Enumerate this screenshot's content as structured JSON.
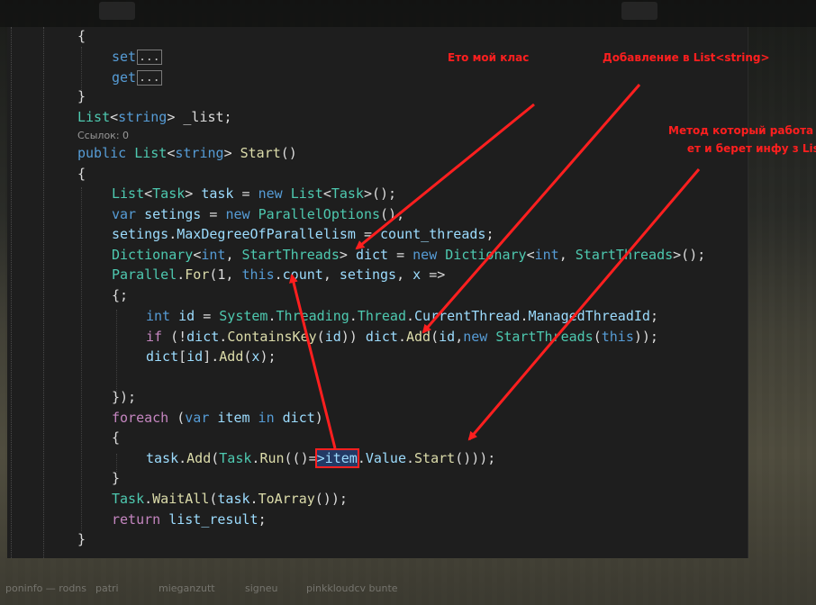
{
  "taskbar": {
    "items": [
      "poninfo —\n  rodns",
      "patri",
      "mieganzutt",
      "signeu",
      "pinkkloudcv\n  bunte"
    ]
  },
  "refs_label": "Ссылок: 0",
  "code": {
    "l1": "{",
    "l2_kw": "set",
    "l3_kw": "get",
    "fold": "...",
    "l4": "}",
    "l5_type": "List",
    "l5_lt": "<",
    "l5_str": "string",
    "l5_rest": "> _list;",
    "l6_kw1": "public",
    "l6_type": "List",
    "l6_lt": "<",
    "l6_str": "string",
    "l6_gt": "> ",
    "l6_me": "Start",
    "l6_par": "()",
    "l7": "{",
    "l8_t1": "List",
    "l8_a": "<",
    "l8_t2": "Task",
    "l8_b": "> ",
    "l8_v": "task",
    "l8_c": " = ",
    "l8_new": "new",
    "l8_d": " ",
    "l8_t3": "List",
    "l8_e": "<",
    "l8_t4": "Task",
    "l8_f": ">();",
    "l9_var": "var",
    "l9_v": " setings",
    "l9_a": " = ",
    "l9_new": "new",
    "l9_b": " ",
    "l9_t": "ParallelOptions",
    "l9_c": "();",
    "l10_v": "setings",
    "l10_a": ".",
    "l10_p": "MaxDegreeOfParallelism",
    "l10_b": " = ",
    "l10_v2": "count_threads",
    "l10_c": ";",
    "l11_t1": "Dictionary",
    "l11_a": "<",
    "l11_int": "int",
    "l11_b": ", ",
    "l11_t2": "StartThreads",
    "l11_c": "> ",
    "l11_v": "dict",
    "l11_d": " = ",
    "l11_new": "new",
    "l11_e": " ",
    "l11_t3": "Dictionary",
    "l11_f": "<",
    "l11_int2": "int",
    "l11_g": ", ",
    "l11_t4": "StartThreads",
    "l11_h": ">();",
    "l12_t": "Parallel",
    "l12_a": ".",
    "l12_m": "For",
    "l12_b": "(1, ",
    "l12_this": "this",
    "l12_c": ".",
    "l12_p": "count",
    "l12_d": ", ",
    "l12_v": "setings",
    "l12_e": ", ",
    "l12_x": "x",
    "l12_f": " =>",
    "l13": "{;",
    "l14_int": "int",
    "l14_v": " id",
    "l14_a": " = ",
    "l14_ns": "System",
    "l14_b": ".",
    "l14_ns2": "Threading",
    "l14_c": ".",
    "l14_t": "Thread",
    "l14_d": ".",
    "l14_p": "CurrentThread",
    "l14_e": ".",
    "l14_p2": "ManagedThreadId",
    "l14_f": ";",
    "l15_if": "if",
    "l15_a": " (!",
    "l15_v": "dict",
    "l15_b": ".",
    "l15_m": "ContainsKey",
    "l15_c": "(",
    "l15_id": "id",
    "l15_d": ")) ",
    "l15_v2": "dict",
    "l15_e": ".",
    "l15_m2": "Add",
    "l15_f": "(",
    "l15_id2": "id",
    "l15_g": ",",
    "l15_new": "new",
    "l15_h": " ",
    "l15_t": "StartThreads",
    "l15_i": "(",
    "l15_this": "this",
    "l15_j": "));",
    "l16_v": "dict",
    "l16_a": "[",
    "l16_id": "id",
    "l16_b": "].",
    "l16_m": "Add",
    "l16_c": "(",
    "l16_x": "x",
    "l16_d": ");",
    "l17": "});",
    "l18_fe": "foreach",
    "l18_a": " (",
    "l18_var": "var",
    "l18_v": " item",
    "l18_in": " in",
    "l18_v2": " dict",
    "l18_b": ")",
    "l19": "{",
    "l20_v": "task",
    "l20_a": ".",
    "l20_m": "Add",
    "l20_b": "(",
    "l20_t": "Task",
    "l20_c": ".",
    "l20_m2": "Run",
    "l20_d": "(()=",
    "l20_hl": ">item",
    "l20_e": ".",
    "l20_p": "Value",
    "l20_f": ".",
    "l20_m3": "Start",
    "l20_g": "()));",
    "l21": "}",
    "l22_t": "Task",
    "l22_a": ".",
    "l22_m": "WaitAll",
    "l22_b": "(",
    "l22_v": "task",
    "l22_c": ".",
    "l22_m2": "ToArray",
    "l22_d": "());",
    "l23_ret": "return",
    "l23_v": " list_result",
    "l23_a": ";",
    "l24": "}"
  },
  "annotations": {
    "my_class": "Ето мой клас",
    "add_to_list": "Добавление в List<string>",
    "method": "Метод который работа\n     ет и берет инфу з List"
  },
  "colors": {
    "annotation": "#ff1f1f",
    "keyword": "#569cd6",
    "type": "#4ec9b0",
    "method": "#dcdcaa",
    "variable": "#9cdcfe",
    "control": "#c586c0"
  }
}
